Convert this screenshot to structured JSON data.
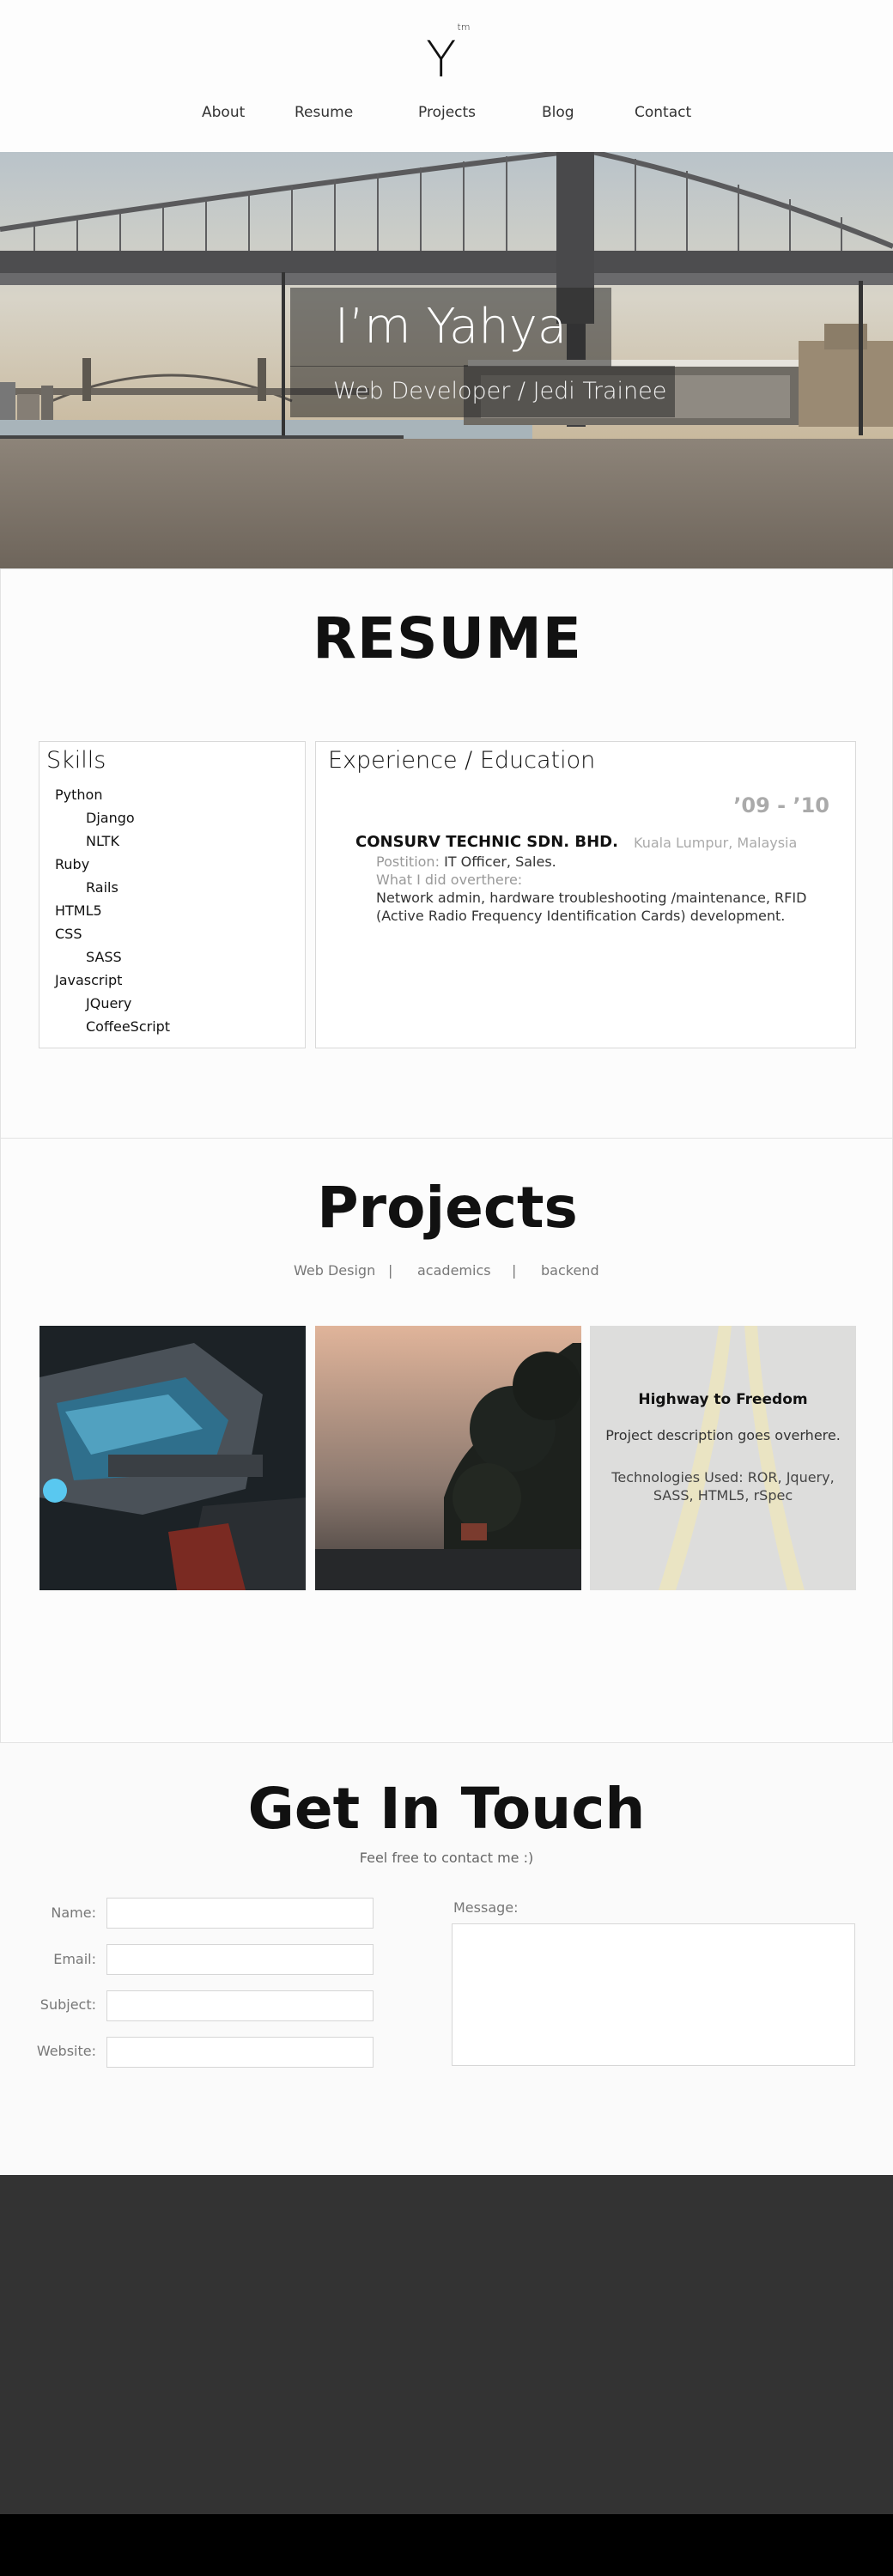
{
  "header": {
    "logo": "Y",
    "logo_mark": "tm",
    "nav": [
      "About",
      "Resume",
      "Projects",
      "Blog",
      "Contact"
    ]
  },
  "hero": {
    "title": "I’m Yahya",
    "subtitle": "Web Developer / Jedi Trainee"
  },
  "resume": {
    "title": "RESUME",
    "skills_heading": "Skills",
    "skills": [
      {
        "name": "Python",
        "sub": [
          "Django",
          "NLTK"
        ]
      },
      {
        "name": "Ruby",
        "sub": [
          "Rails"
        ]
      },
      {
        "name": "HTML5",
        "sub": []
      },
      {
        "name": "CSS",
        "sub": [
          "SASS"
        ]
      },
      {
        "name": "Javascript",
        "sub": [
          "JQuery",
          "CoffeeScript"
        ]
      }
    ],
    "experience_heading": "Experience / Education",
    "entry": {
      "dates": "’09 - ’10",
      "company": "CONSURV TECHNIC SDN. BHD.",
      "location": "Kuala Lumpur, Malaysia",
      "position_label": "Postition:",
      "position": "IT Officer, Sales.",
      "did_label": "What I did overthere:",
      "description": "Network admin, hardware troubleshooting /maintenance, RFID (Active Radio Frequency Identification Cards) development."
    }
  },
  "projects": {
    "title": "Projects",
    "filters": [
      "Web Design",
      "academics",
      "backend"
    ],
    "separator": "|",
    "featured": {
      "title": "Highway to Freedom",
      "description": "Project description goes overhere.",
      "tech": "Technologies Used: ROR, Jquery, SASS, HTML5, rSpec"
    }
  },
  "contact": {
    "title": "Get In Touch",
    "subtitle": "Feel free to contact me :)",
    "fields": [
      "Name:",
      "Email:",
      "Subject:",
      "Website:"
    ],
    "message_label": "Message:"
  },
  "colors": {
    "footer": "#333333",
    "bottom_bar": "#000000",
    "overlay": "#282828"
  }
}
